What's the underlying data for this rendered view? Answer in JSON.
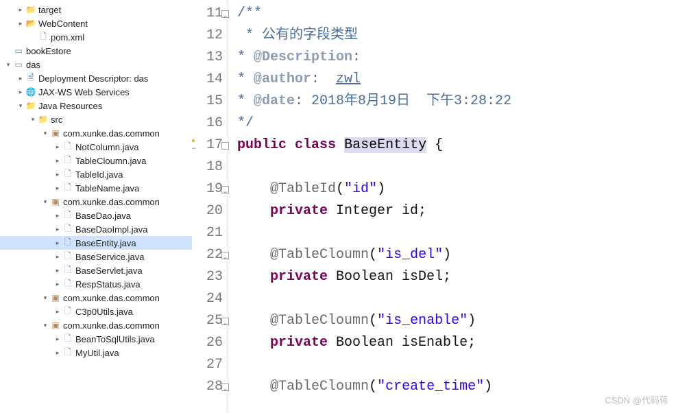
{
  "explorer": {
    "rows": [
      {
        "depth": 1,
        "arrow": "›",
        "icon": "folder",
        "label": "target"
      },
      {
        "depth": 1,
        "arrow": "›",
        "icon": "folder-open",
        "label": "WebContent"
      },
      {
        "depth": 2,
        "arrow": "",
        "icon": "xml",
        "label": "pom.xml"
      },
      {
        "depth": 0,
        "arrow": "",
        "icon": "proj",
        "label": "bookEstore"
      },
      {
        "depth": 0,
        "arrow": "ˇ",
        "icon": "ear",
        "label": "das"
      },
      {
        "depth": 1,
        "arrow": "›",
        "icon": "doc",
        "label": "Deployment Descriptor: das"
      },
      {
        "depth": 1,
        "arrow": "›",
        "icon": "globe",
        "label": "JAX-WS Web Services"
      },
      {
        "depth": 1,
        "arrow": "ˇ",
        "icon": "folder-blue",
        "label": "Java Resources"
      },
      {
        "depth": 2,
        "arrow": "ˇ",
        "icon": "folder-src",
        "label": "src"
      },
      {
        "depth": 3,
        "arrow": "ˇ",
        "icon": "pkg",
        "label": "com.xunke.das.common"
      },
      {
        "depth": 4,
        "arrow": "›",
        "icon": "java",
        "label": "NotColumn.java"
      },
      {
        "depth": 4,
        "arrow": "›",
        "icon": "java",
        "label": "TableCloumn.java"
      },
      {
        "depth": 4,
        "arrow": "›",
        "icon": "java",
        "label": "TableId.java"
      },
      {
        "depth": 4,
        "arrow": "›",
        "icon": "java",
        "label": "TableName.java"
      },
      {
        "depth": 3,
        "arrow": "ˇ",
        "icon": "pkg",
        "label": "com.xunke.das.common"
      },
      {
        "depth": 4,
        "arrow": "›",
        "icon": "java",
        "label": "BaseDao.java"
      },
      {
        "depth": 4,
        "arrow": "›",
        "icon": "java",
        "label": "BaseDaoImpl.java"
      },
      {
        "depth": 4,
        "arrow": "›",
        "icon": "java",
        "label": "BaseEntity.java",
        "selected": true
      },
      {
        "depth": 4,
        "arrow": "›",
        "icon": "java",
        "label": "BaseService.java"
      },
      {
        "depth": 4,
        "arrow": "›",
        "icon": "java",
        "label": "BaseServlet.java"
      },
      {
        "depth": 4,
        "arrow": "›",
        "icon": "java",
        "label": "RespStatus.java"
      },
      {
        "depth": 3,
        "arrow": "ˇ",
        "icon": "pkg",
        "label": "com.xunke.das.common"
      },
      {
        "depth": 4,
        "arrow": "›",
        "icon": "java",
        "label": "C3p0Utils.java"
      },
      {
        "depth": 3,
        "arrow": "ˇ",
        "icon": "pkg",
        "label": "com.xunke.das.common"
      },
      {
        "depth": 4,
        "arrow": "›",
        "icon": "java",
        "label": "BeanToSqlUtils.java"
      },
      {
        "depth": 4,
        "arrow": "›",
        "icon": "java",
        "label": "MyUtil.java"
      }
    ]
  },
  "editor": {
    "lines": [
      {
        "n": 11,
        "marker": "fold",
        "tokens": [
          {
            "t": "/**",
            "c": "jd"
          }
        ]
      },
      {
        "n": 12,
        "tokens": [
          {
            "t": " * ",
            "c": "jd"
          },
          {
            "t": "公有的字段类型",
            "c": "jd"
          }
        ]
      },
      {
        "n": 13,
        "tokens": [
          {
            "t": "* ",
            "c": "jd"
          },
          {
            "t": "@Description",
            "c": "jdtag"
          },
          {
            "t": ":",
            "c": "jd"
          }
        ]
      },
      {
        "n": 14,
        "tokens": [
          {
            "t": "* ",
            "c": "jd"
          },
          {
            "t": "@author",
            "c": "jdtag"
          },
          {
            "t": ":  ",
            "c": "jd"
          },
          {
            "t": "zwl",
            "c": "jd ul"
          }
        ]
      },
      {
        "n": 15,
        "tokens": [
          {
            "t": "* ",
            "c": "jd"
          },
          {
            "t": "@date",
            "c": "jdtag"
          },
          {
            "t": ": 2018年8月19日  下午3:28:22",
            "c": "jd"
          }
        ]
      },
      {
        "n": 16,
        "tokens": [
          {
            "t": "*/",
            "c": "jd"
          }
        ]
      },
      {
        "n": 17,
        "marker": "dot-fold",
        "tokens": [
          {
            "t": "public",
            "c": "kw"
          },
          {
            "t": " "
          },
          {
            "t": "class",
            "c": "kw"
          },
          {
            "t": " "
          },
          {
            "t": "BaseEntity",
            "c": "type hl"
          },
          {
            "t": " {"
          }
        ]
      },
      {
        "n": 18,
        "tokens": []
      },
      {
        "n": 19,
        "marker": "fold",
        "tokens": [
          {
            "t": "    "
          },
          {
            "t": "@TableId",
            "c": "ann"
          },
          {
            "t": "("
          },
          {
            "t": "\"id\"",
            "c": "str"
          },
          {
            "t": ")"
          }
        ]
      },
      {
        "n": 20,
        "tokens": [
          {
            "t": "    "
          },
          {
            "t": "private",
            "c": "kw"
          },
          {
            "t": " Integer id;"
          }
        ]
      },
      {
        "n": 21,
        "tokens": []
      },
      {
        "n": 22,
        "marker": "fold",
        "tokens": [
          {
            "t": "    "
          },
          {
            "t": "@TableCloumn",
            "c": "ann"
          },
          {
            "t": "("
          },
          {
            "t": "\"is_del\"",
            "c": "str"
          },
          {
            "t": ")"
          }
        ]
      },
      {
        "n": 23,
        "tokens": [
          {
            "t": "    "
          },
          {
            "t": "private",
            "c": "kw"
          },
          {
            "t": " Boolean isDel;"
          }
        ]
      },
      {
        "n": 24,
        "tokens": []
      },
      {
        "n": 25,
        "marker": "fold",
        "tokens": [
          {
            "t": "    "
          },
          {
            "t": "@TableCloumn",
            "c": "ann"
          },
          {
            "t": "("
          },
          {
            "t": "\"is_enable\"",
            "c": "str"
          },
          {
            "t": ")"
          }
        ]
      },
      {
        "n": 26,
        "tokens": [
          {
            "t": "    "
          },
          {
            "t": "private",
            "c": "kw"
          },
          {
            "t": " Boolean isEnable;"
          }
        ]
      },
      {
        "n": 27,
        "tokens": []
      },
      {
        "n": 28,
        "marker": "fold",
        "tokens": [
          {
            "t": "    "
          },
          {
            "t": "@TableCloumn",
            "c": "ann"
          },
          {
            "t": "("
          },
          {
            "t": "\"create_time\"",
            "c": "str"
          },
          {
            "t": ")"
          }
        ]
      }
    ]
  },
  "watermark": "CSDN @代码蒋",
  "iconGlyphs": {
    "folder": "📁",
    "folder-open": "📂",
    "folder-blue": "📁",
    "folder-src": "📁",
    "pkg": "▣",
    "java": "🗋",
    "xml": "🗋",
    "proj": "▭",
    "ear": "▭",
    "doc": "🗎",
    "globe": "🌐"
  }
}
